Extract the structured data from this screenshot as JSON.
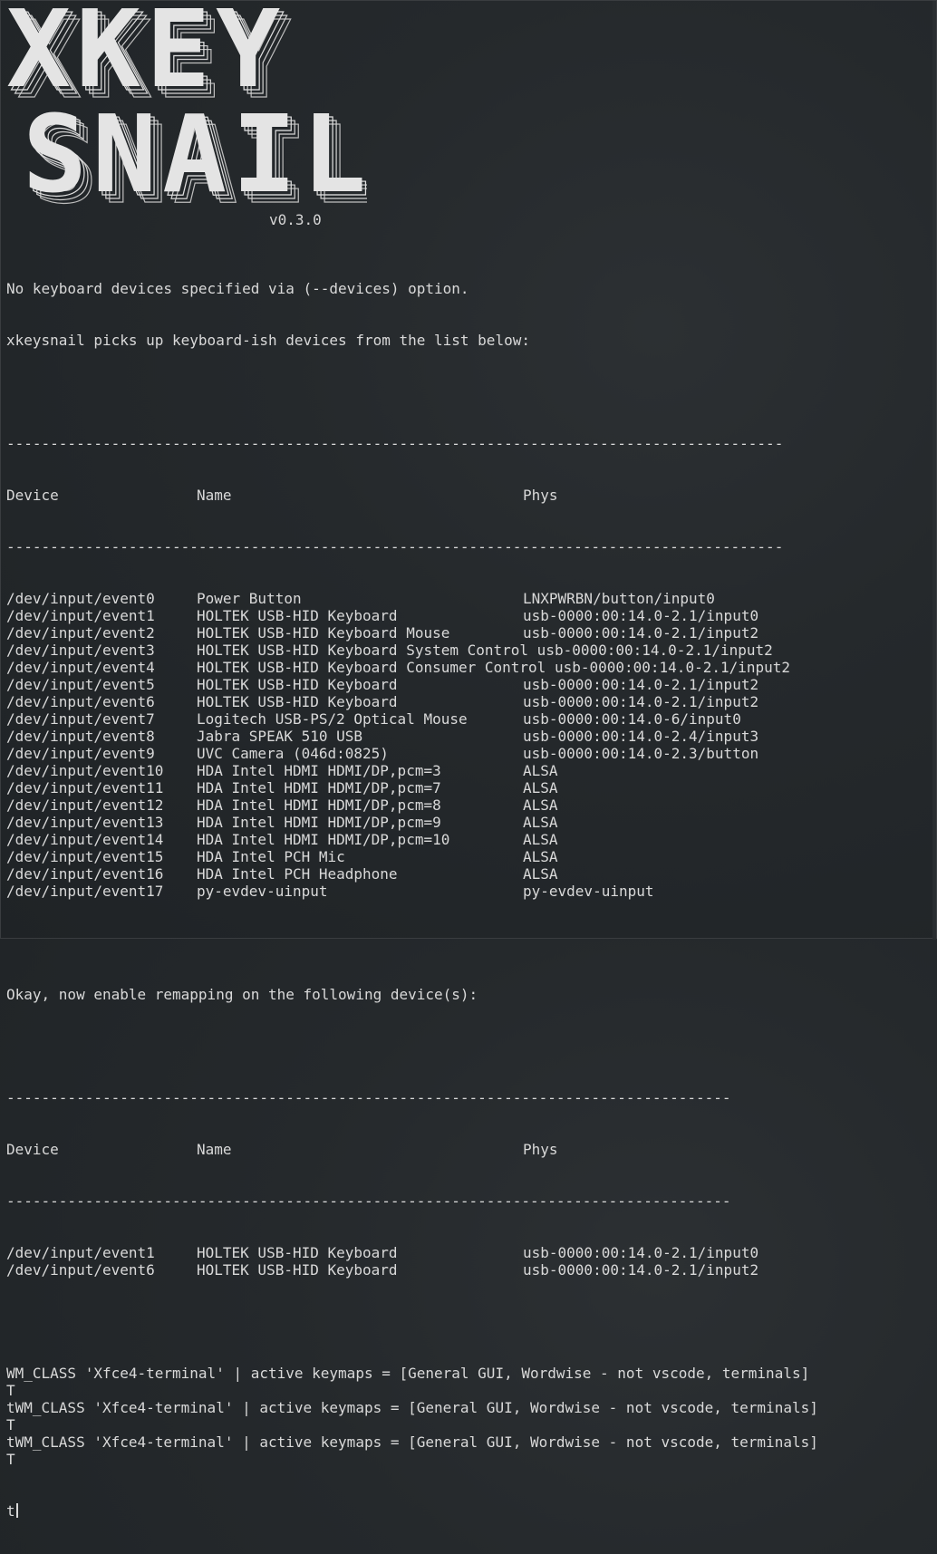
{
  "banner": {
    "word1": "XKEY",
    "word2": "SNAIL",
    "version": "v0.3.0"
  },
  "intro": [
    "No keyboard devices specified via (--devices) option.",
    "xkeysnail picks up keyboard-ish devices from the list below:"
  ],
  "table1": {
    "rule": "-----------------------------------------------------------------------------------------",
    "headers": [
      "Device",
      "Name",
      "Phys"
    ],
    "rows": [
      [
        "/dev/input/event0",
        "Power Button",
        "LNXPWRBN/button/input0"
      ],
      [
        "/dev/input/event1",
        "HOLTEK USB-HID Keyboard",
        "usb-0000:00:14.0-2.1/input0"
      ],
      [
        "/dev/input/event2",
        "HOLTEK USB-HID Keyboard Mouse",
        "usb-0000:00:14.0-2.1/input2"
      ],
      [
        "/dev/input/event3",
        "HOLTEK USB-HID Keyboard System Control usb-0000:00:14.0-2.1/input2",
        ""
      ],
      [
        "/dev/input/event4",
        "HOLTEK USB-HID Keyboard Consumer Control usb-0000:00:14.0-2.1/input2",
        ""
      ],
      [
        "/dev/input/event5",
        "HOLTEK USB-HID Keyboard",
        "usb-0000:00:14.0-2.1/input2"
      ],
      [
        "/dev/input/event6",
        "HOLTEK USB-HID Keyboard",
        "usb-0000:00:14.0-2.1/input2"
      ],
      [
        "/dev/input/event7",
        "Logitech USB-PS/2 Optical Mouse",
        "usb-0000:00:14.0-6/input0"
      ],
      [
        "/dev/input/event8",
        "Jabra SPEAK 510 USB",
        "usb-0000:00:14.0-2.4/input3"
      ],
      [
        "/dev/input/event9",
        "UVC Camera (046d:0825)",
        "usb-0000:00:14.0-2.3/button"
      ],
      [
        "/dev/input/event10",
        "HDA Intel HDMI HDMI/DP,pcm=3",
        "ALSA"
      ],
      [
        "/dev/input/event11",
        "HDA Intel HDMI HDMI/DP,pcm=7",
        "ALSA"
      ],
      [
        "/dev/input/event12",
        "HDA Intel HDMI HDMI/DP,pcm=8",
        "ALSA"
      ],
      [
        "/dev/input/event13",
        "HDA Intel HDMI HDMI/DP,pcm=9",
        "ALSA"
      ],
      [
        "/dev/input/event14",
        "HDA Intel HDMI HDMI/DP,pcm=10",
        "ALSA"
      ],
      [
        "/dev/input/event15",
        "HDA Intel PCH Mic",
        "ALSA"
      ],
      [
        "/dev/input/event16",
        "HDA Intel PCH Headphone",
        "ALSA"
      ],
      [
        "/dev/input/event17",
        "py-evdev-uinput",
        "py-evdev-uinput"
      ]
    ]
  },
  "enable_msg": "Okay, now enable remapping on the following device(s):",
  "table2": {
    "rule": "-----------------------------------------------------------------------------------",
    "headers": [
      "Device",
      "Name",
      "Phys"
    ],
    "rows": [
      [
        "/dev/input/event1",
        "HOLTEK USB-HID Keyboard",
        "usb-0000:00:14.0-2.1/input0"
      ],
      [
        "/dev/input/event6",
        "HOLTEK USB-HID Keyboard",
        "usb-0000:00:14.0-2.1/input2"
      ]
    ]
  },
  "log": [
    "WM_CLASS 'Xfce4-terminal' | active keymaps = [General GUI, Wordwise - not vscode, terminals]",
    "T",
    "tWM_CLASS 'Xfce4-terminal' | active keymaps = [General GUI, Wordwise - not vscode, terminals]",
    "T",
    "tWM_CLASS 'Xfce4-terminal' | active keymaps = [General GUI, Wordwise - not vscode, terminals]",
    "T"
  ],
  "prompt_line": "t"
}
